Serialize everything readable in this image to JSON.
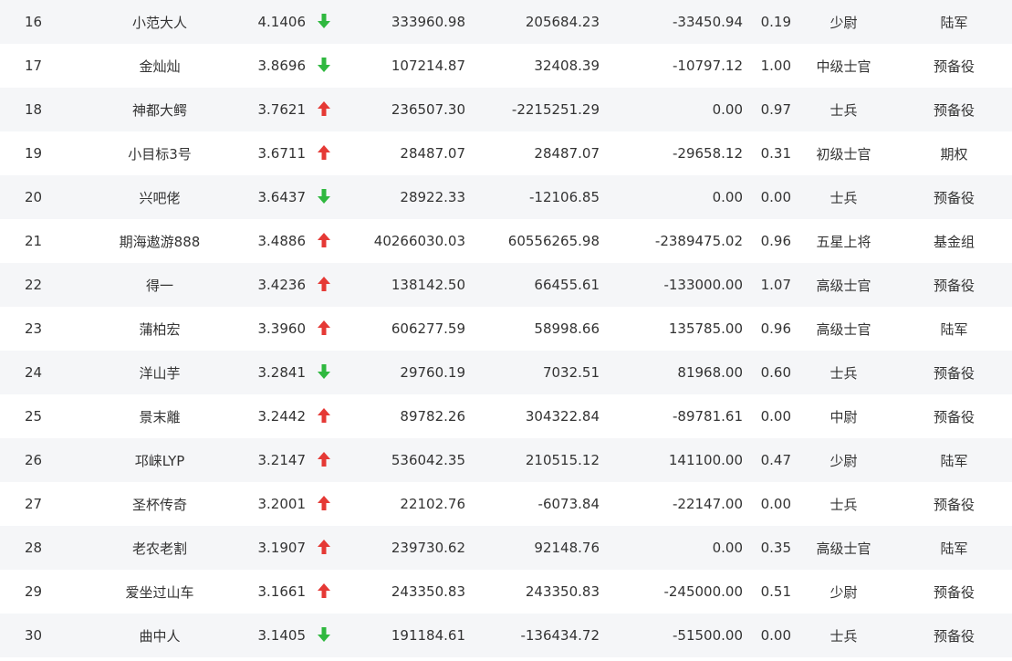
{
  "colors": {
    "up": "#e53935",
    "down": "#2fb83f",
    "stripe": "#f5f6f8"
  },
  "rows": [
    {
      "rank": "16",
      "name": "小范大人",
      "score": "4.1406",
      "trend": "down",
      "v1": "333960.98",
      "v2": "205684.23",
      "v3": "-33450.94",
      "ratio": "0.19",
      "rank_title": "少尉",
      "group": "陆军"
    },
    {
      "rank": "17",
      "name": "金灿灿",
      "score": "3.8696",
      "trend": "down",
      "v1": "107214.87",
      "v2": "32408.39",
      "v3": "-10797.12",
      "ratio": "1.00",
      "rank_title": "中级士官",
      "group": "预备役"
    },
    {
      "rank": "18",
      "name": "神都大鳄",
      "score": "3.7621",
      "trend": "up",
      "v1": "236507.30",
      "v2": "-2215251.29",
      "v3": "0.00",
      "ratio": "0.97",
      "rank_title": "士兵",
      "group": "预备役"
    },
    {
      "rank": "19",
      "name": "小目标3号",
      "score": "3.6711",
      "trend": "up",
      "v1": "28487.07",
      "v2": "28487.07",
      "v3": "-29658.12",
      "ratio": "0.31",
      "rank_title": "初级士官",
      "group": "期权"
    },
    {
      "rank": "20",
      "name": "兴吧佬",
      "score": "3.6437",
      "trend": "down",
      "v1": "28922.33",
      "v2": "-12106.85",
      "v3": "0.00",
      "ratio": "0.00",
      "rank_title": "士兵",
      "group": "预备役"
    },
    {
      "rank": "21",
      "name": "期海遨游888",
      "score": "3.4886",
      "trend": "up",
      "v1": "40266030.03",
      "v2": "60556265.98",
      "v3": "-2389475.02",
      "ratio": "0.96",
      "rank_title": "五星上将",
      "group": "基金组"
    },
    {
      "rank": "22",
      "name": "得一",
      "score": "3.4236",
      "trend": "up",
      "v1": "138142.50",
      "v2": "66455.61",
      "v3": "-133000.00",
      "ratio": "1.07",
      "rank_title": "高级士官",
      "group": "预备役"
    },
    {
      "rank": "23",
      "name": "蒲柏宏",
      "score": "3.3960",
      "trend": "up",
      "v1": "606277.59",
      "v2": "58998.66",
      "v3": "135785.00",
      "ratio": "0.96",
      "rank_title": "高级士官",
      "group": "陆军"
    },
    {
      "rank": "24",
      "name": "洋山芋",
      "score": "3.2841",
      "trend": "down",
      "v1": "29760.19",
      "v2": "7032.51",
      "v3": "81968.00",
      "ratio": "0.60",
      "rank_title": "士兵",
      "group": "预备役"
    },
    {
      "rank": "25",
      "name": "景末離",
      "score": "3.2442",
      "trend": "up",
      "v1": "89782.26",
      "v2": "304322.84",
      "v3": "-89781.61",
      "ratio": "0.00",
      "rank_title": "中尉",
      "group": "预备役"
    },
    {
      "rank": "26",
      "name": "邛崃LYP",
      "score": "3.2147",
      "trend": "up",
      "v1": "536042.35",
      "v2": "210515.12",
      "v3": "141100.00",
      "ratio": "0.47",
      "rank_title": "少尉",
      "group": "陆军"
    },
    {
      "rank": "27",
      "name": "圣杯传奇",
      "score": "3.2001",
      "trend": "up",
      "v1": "22102.76",
      "v2": "-6073.84",
      "v3": "-22147.00",
      "ratio": "0.00",
      "rank_title": "士兵",
      "group": "预备役"
    },
    {
      "rank": "28",
      "name": "老农老割",
      "score": "3.1907",
      "trend": "up",
      "v1": "239730.62",
      "v2": "92148.76",
      "v3": "0.00",
      "ratio": "0.35",
      "rank_title": "高级士官",
      "group": "陆军"
    },
    {
      "rank": "29",
      "name": "爱坐过山车",
      "score": "3.1661",
      "trend": "up",
      "v1": "243350.83",
      "v2": "243350.83",
      "v3": "-245000.00",
      "ratio": "0.51",
      "rank_title": "少尉",
      "group": "预备役"
    },
    {
      "rank": "30",
      "name": "曲中人",
      "score": "3.1405",
      "trend": "down",
      "v1": "191184.61",
      "v2": "-136434.72",
      "v3": "-51500.00",
      "ratio": "0.00",
      "rank_title": "士兵",
      "group": "预备役"
    }
  ]
}
